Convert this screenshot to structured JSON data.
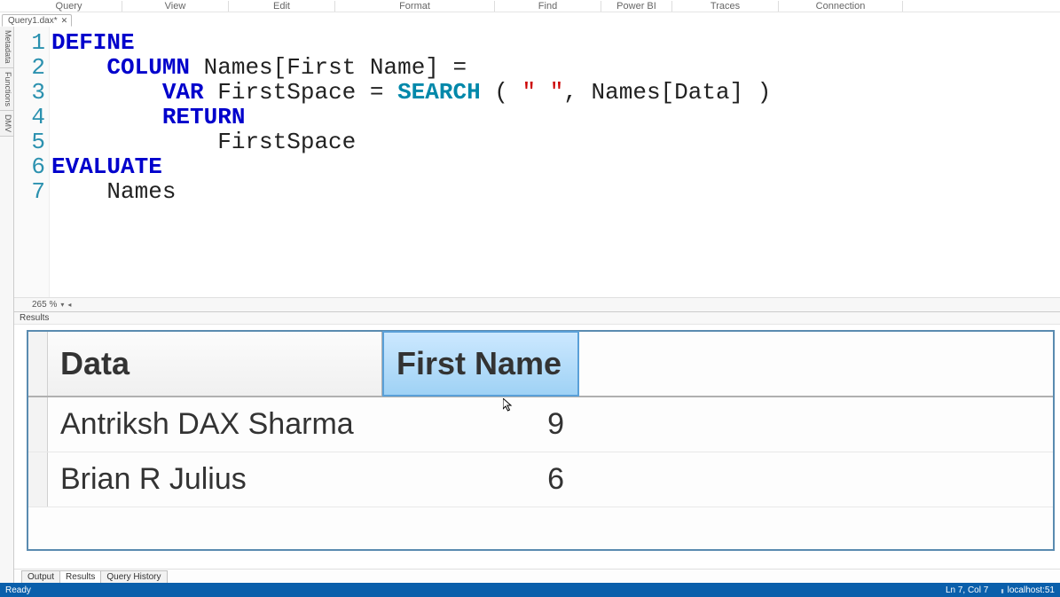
{
  "menu": {
    "query": "Query",
    "view": "View",
    "edit": "Edit",
    "format": "Format",
    "find": "Find",
    "powerbi": "Power BI",
    "traces": "Traces",
    "connection": "Connection"
  },
  "file_tab": {
    "name": "Query1.dax*",
    "close_glyph": "✕"
  },
  "side_tabs": {
    "metadata": "Metadata",
    "functions": "Functions",
    "dmv": "DMV"
  },
  "editor": {
    "lines": [
      "1",
      "2",
      "3",
      "4",
      "5",
      "6",
      "7"
    ],
    "tokens": {
      "define": "DEFINE",
      "column": "COLUMN",
      "names_first": " Names[First Name] = ",
      "var": "VAR",
      "firstspace_eq": " FirstSpace = ",
      "search": "SEARCH",
      "paren_open": " ( ",
      "str_space": "\" \"",
      "after_str": ", Names[Data] )",
      "return": "RETURN",
      "firstspace_val": "FirstSpace",
      "evaluate": "EVALUATE",
      "names": "Names"
    },
    "zoom": "265 %"
  },
  "results_label": "Results",
  "grid": {
    "columns": {
      "data": "Data",
      "first_name": "First Name"
    },
    "rows": [
      {
        "data": "Antriksh DAX Sharma",
        "first_name": "9"
      },
      {
        "data": "Brian R Julius",
        "first_name": "6"
      }
    ]
  },
  "bottom_tabs": {
    "output": "Output",
    "results": "Results",
    "history": "Query History"
  },
  "status": {
    "ready": "Ready",
    "pos": "Ln 7, Col 7",
    "conn": "localhost:51"
  },
  "chart_data": {
    "type": "table",
    "columns": [
      "Data",
      "First Name"
    ],
    "rows": [
      [
        "Antriksh DAX Sharma",
        9
      ],
      [
        "Brian R Julius",
        6
      ]
    ]
  }
}
